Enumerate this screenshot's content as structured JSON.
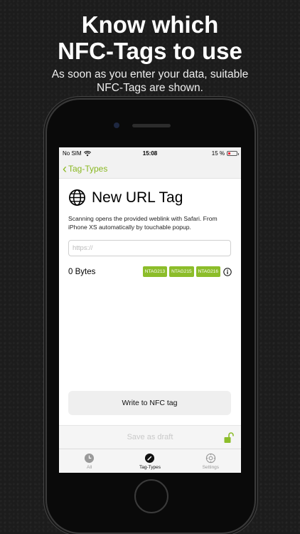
{
  "promo": {
    "headline_line1": "Know which",
    "headline_line2": "NFC-Tags to use",
    "sub_line1": "As soon as you enter your data, suitable",
    "sub_line2": "NFC-Tags are shown."
  },
  "status_bar": {
    "carrier": "No SIM",
    "time": "15:08",
    "battery": "15 %"
  },
  "nav": {
    "back_label": "Tag-Types"
  },
  "page": {
    "title": "New URL Tag",
    "title_icon": "globe-icon",
    "description": "Scanning opens the provided weblink with Safari. From iPhone XS automatically by touchable popup.",
    "url_placeholder": "https://",
    "url_value": "",
    "bytes": "0 Bytes",
    "tags": [
      "NTAG213",
      "NTAG215",
      "NTAG216"
    ],
    "write_button": "Write to NFC tag",
    "save_draft": "Save as draft"
  },
  "tabs": [
    {
      "label": "All",
      "icon": "clock-icon",
      "active": false
    },
    {
      "label": "Tag-Types",
      "icon": "pen-icon",
      "active": true
    },
    {
      "label": "Settings",
      "icon": "gear-icon",
      "active": false
    }
  ],
  "colors": {
    "accent": "#8cbd2a",
    "background": "#1c1c1c"
  }
}
